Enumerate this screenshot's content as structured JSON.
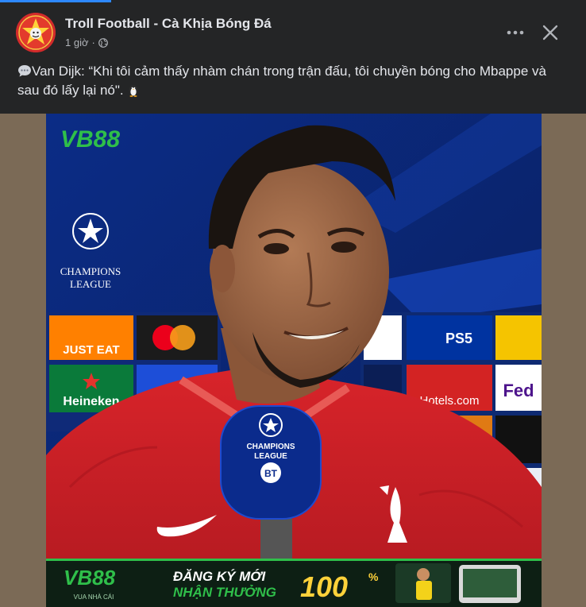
{
  "post": {
    "page_name": "Troll Football - Cà Khịa Bóng Đá",
    "time": "1 giờ",
    "caption": "Van Dijk: “Khi tôi cảm thấy nhàm chán trong trận đấu, tôi chuyền bóng cho Mbappe và sau đó lấy lại nó\"."
  },
  "image": {
    "brand": "VB88",
    "ucl_line1": "CHAMPIONS",
    "ucl_line2": "LEAGUE",
    "sponsors": [
      "JUST EAT",
      "Heineken",
      "PS5",
      "Hotels.com",
      "Fed"
    ],
    "mic_line1": "CHAMPIONS",
    "mic_line2": "LEAGUE",
    "mic_bt": "BT",
    "banner_brand": "VB88",
    "banner_tagline": "VUA NHÀ CÁI",
    "banner_line1": "ĐĂNG KÝ MỚI",
    "banner_line2": "NHẬN THƯỞNG",
    "banner_amount": "100",
    "banner_percent": "%"
  },
  "colors": {
    "background": "#242526",
    "text": "#e4e6eb",
    "secondary_text": "#b0b3b8",
    "accent": "#2d88ff",
    "frame": "#7b6a56"
  },
  "icons": [
    "page-avatar-icon",
    "globe-icon",
    "more-options-icon",
    "close-icon",
    "speech-bubble-icon",
    "penguin-icon"
  ]
}
